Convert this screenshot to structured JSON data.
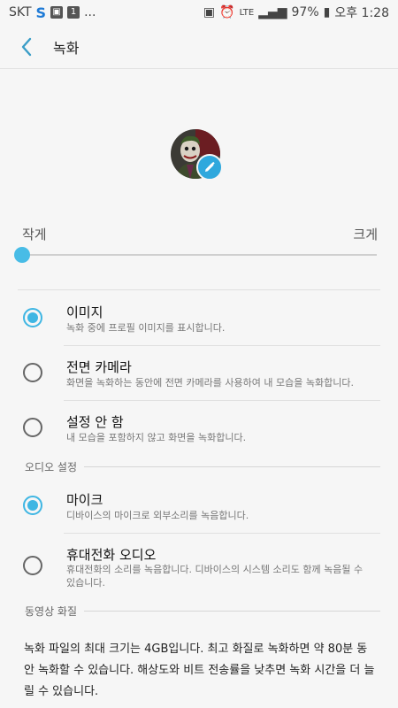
{
  "status": {
    "carrier": "SKT",
    "dots": "...",
    "lte": "LTE",
    "battery": "97%",
    "time": "오후 1:28"
  },
  "appbar": {
    "title": "녹화"
  },
  "size": {
    "small_label": "작게",
    "large_label": "크게",
    "value": 0
  },
  "options": [
    {
      "title": "이미지",
      "desc": "녹화 중에 프로필 이미지를 표시합니다.",
      "checked": true
    },
    {
      "title": "전면 카메라",
      "desc": "화면을 녹화하는 동안에 전면 카메라를 사용하여 내 모습을 녹화합니다.",
      "checked": false
    },
    {
      "title": "설정 안 함",
      "desc": "내 모습을 포함하지 않고 화면을 녹화합니다.",
      "checked": false
    }
  ],
  "audio": {
    "header": "오디오 설정",
    "options": [
      {
        "title": "마이크",
        "desc": "디바이스의 마이크로 외부소리를 녹음합니다.",
        "checked": true
      },
      {
        "title": "휴대전화 오디오",
        "desc": "휴대전화의 소리를 녹음합니다. 디바이스의 시스템 소리도 함께 녹음될 수 있습니다.",
        "checked": false
      }
    ]
  },
  "video": {
    "header": "동영상 화질",
    "info": "녹화 파일의 최대 크기는 4GB입니다. 최고 화질로 녹화하면 약 80분 동안 녹화할 수 있습니다. 해상도와 비트 전송률을 낮추면 녹화 시간을 더 늘릴 수 있습니다."
  },
  "colors": {
    "accent": "#3fb6e3",
    "background": "#f6f6f6"
  }
}
